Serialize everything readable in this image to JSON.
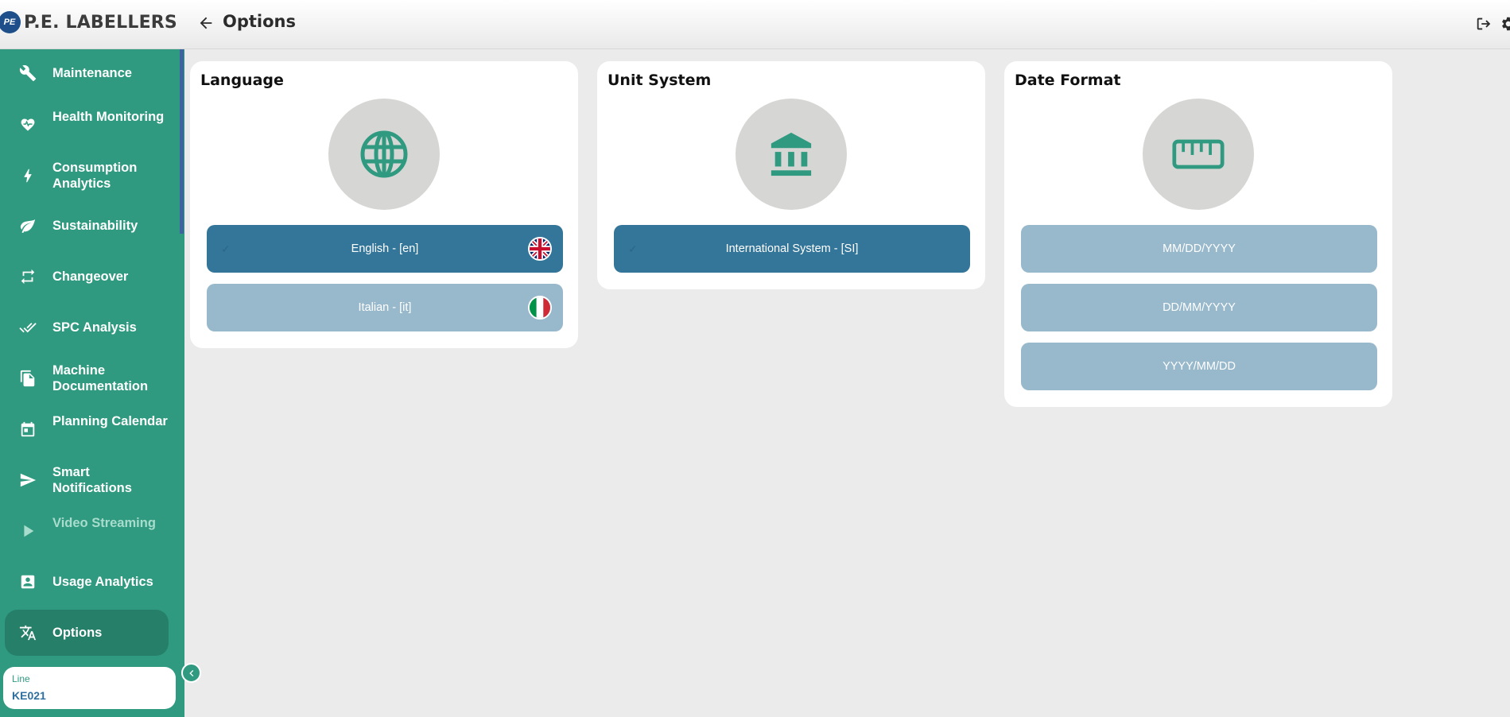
{
  "header": {
    "logo_text": "P.E. LABELLERS",
    "logo_badge": "PE",
    "title": "Options",
    "icons": [
      "arrow-left-icon",
      "logout-icon",
      "gear-icon"
    ]
  },
  "sidebar": {
    "items": [
      {
        "label": "Maintenance",
        "icon": "wrench-icon"
      },
      {
        "label": "Health Monitoring",
        "icon": "heart-pulse-icon"
      },
      {
        "label": "Consumption Analytics",
        "icon": "bolt-icon"
      },
      {
        "label": "Sustainability",
        "icon": "leaf-icon"
      },
      {
        "label": "Changeover",
        "icon": "repeat-icon"
      },
      {
        "label": "SPC Analysis",
        "icon": "double-check-icon"
      },
      {
        "label": "Machine Documentation",
        "icon": "document-icon"
      },
      {
        "label": "Planning Calendar",
        "icon": "calendar-icon"
      },
      {
        "label": "Smart Notifications",
        "icon": "send-icon"
      },
      {
        "label": "Video Streaming",
        "icon": "play-icon"
      },
      {
        "label": "Usage Analytics",
        "icon": "account-box-icon"
      },
      {
        "label": "Options",
        "icon": "translate-icon"
      }
    ],
    "active_item": "Options",
    "line": {
      "label": "Line",
      "value": "KE021"
    }
  },
  "cards": {
    "language": {
      "title": "Language",
      "icon": "globe-icon",
      "options": [
        {
          "label": "English - [en]",
          "selected": true,
          "flag": "uk-flag"
        },
        {
          "label": "Italian - [it]",
          "selected": false,
          "flag": "italy-flag"
        }
      ]
    },
    "unit_system": {
      "title": "Unit System",
      "icon": "bank-icon",
      "options": [
        {
          "label": "International System - [SI]",
          "selected": true
        }
      ]
    },
    "date_format": {
      "title": "Date Format",
      "icon": "ruler-icon",
      "options": [
        {
          "label": "MM/DD/YYYY",
          "selected": false
        },
        {
          "label": "DD/MM/YYYY",
          "selected": false
        },
        {
          "label": "YYYY/MM/DD",
          "selected": false
        }
      ]
    }
  },
  "colors": {
    "sidebar": "#2f9a80",
    "sidebar_active": "#267f69",
    "selected_option": "#347699",
    "unselected_option": "#98b8cc",
    "page_background": "#ebebeb",
    "icon_circle": "#d6d6d4"
  }
}
